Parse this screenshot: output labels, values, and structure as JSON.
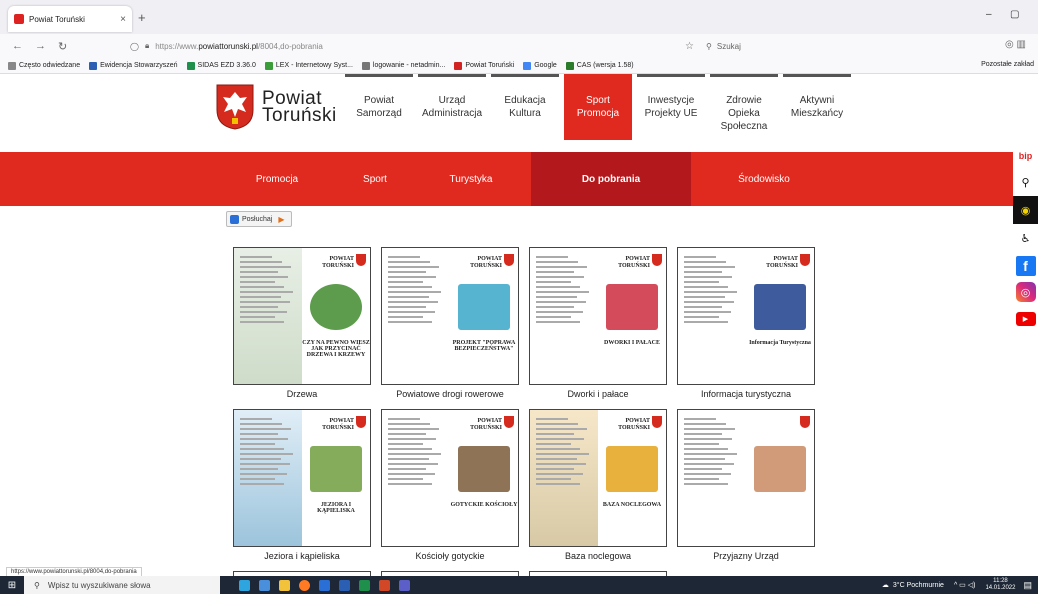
{
  "browser": {
    "tab_title": "Powiat Toruński",
    "tab_close": "×",
    "new_tab": "+",
    "url_prefix": "https://www.",
    "url_domain": "powiattorunski.pl",
    "url_path": "/8004,do-pobrania",
    "search_placeholder": "Szukaj",
    "window_minimize": "–",
    "window_maximize": "▢",
    "bookmarks": [
      {
        "label": "Często odwiedzane",
        "color": "#888888"
      },
      {
        "label": "Ewidencja Stowarzyszeń",
        "color": "#2b5fb3"
      },
      {
        "label": "SIDAS EZD 3.36.0",
        "color": "#1f8f4c"
      },
      {
        "label": "LEX - Internetowy Syst...",
        "color": "#3a9d3a"
      },
      {
        "label": "logowanie - netadmin...",
        "color": "#777777"
      },
      {
        "label": "Powiat Toruński",
        "color": "#d22222"
      },
      {
        "label": "Google",
        "color": "#4285f4"
      },
      {
        "label": "CAS (wersja 1.58)",
        "color": "#2a7c2a"
      }
    ],
    "bookmarks_other": "Pozostałe zakład",
    "status_url": "https://www.powiattorunski.pl/8004,do-pobrania"
  },
  "header": {
    "logo_line1": "Powiat",
    "logo_line2": "Toruński",
    "menu": [
      {
        "l1": "Powiat",
        "l2": "Samorząd",
        "l3": ""
      },
      {
        "l1": "Urząd",
        "l2": "Administracja",
        "l3": ""
      },
      {
        "l1": "Edukacja",
        "l2": "Kultura",
        "l3": ""
      },
      {
        "l1": "Sport",
        "l2": "Promocja",
        "l3": ""
      },
      {
        "l1": "Inwestycje",
        "l2": "Projekty UE",
        "l3": ""
      },
      {
        "l1": "Zdrowie",
        "l2": "Opieka",
        "l3": "Społeczna"
      },
      {
        "l1": "Aktywni",
        "l2": "Mieszkańcy",
        "l3": ""
      }
    ]
  },
  "subnav": {
    "items": [
      "Promocja",
      "Sport",
      "Turystyka",
      "Do pobrania",
      "Środowisko"
    ]
  },
  "sidebar": {
    "bip": "bip"
  },
  "listen": {
    "label": "Posłuchaj"
  },
  "brochures": [
    {
      "caption": "Drzewa",
      "art": "CZY NA PEWNO WIESZ JAK PRZYCINAĆ DRZEWA I KRZEWY",
      "ttl": "POWIAT TORUŃSKI"
    },
    {
      "caption": "Powiatowe drogi rowerowe",
      "art": "PROJEKT \"POPRAWA BEZPIECZEŃSTWA\"",
      "ttl": "POWIAT TORUŃSKI"
    },
    {
      "caption": "Dworki i pałace",
      "art": "DWORKI I PAŁACE",
      "ttl": "POWIAT TORUŃSKI"
    },
    {
      "caption": "Informacja turystyczna",
      "art": "Informacja Turystyczna",
      "ttl": "POWIAT TORUŃSKI"
    },
    {
      "caption": "Jeziora i kąpieliska",
      "art": "JEZIORA I KĄPIELISKA",
      "ttl": "POWIAT TORUŃSKI"
    },
    {
      "caption": "Kościoły gotyckie",
      "art": "GOTYCKIE KOŚCIOŁY",
      "ttl": "POWIAT TORUŃSKI"
    },
    {
      "caption": "Baza noclegowa",
      "art": "BAZA NOCLEGOWA",
      "ttl": "POWIAT TORUŃSKI"
    },
    {
      "caption": "Przyjazny Urząd",
      "art": "",
      "ttl": ""
    }
  ],
  "taskbar": {
    "search": "Wpisz tu wyszukiwane słowa",
    "weather": "3°C Pochmurnie",
    "time": "11:28",
    "date": "14.01.2022"
  },
  "colors": {
    "accent": "#e02a20",
    "accent_dark": "#b3191c"
  }
}
